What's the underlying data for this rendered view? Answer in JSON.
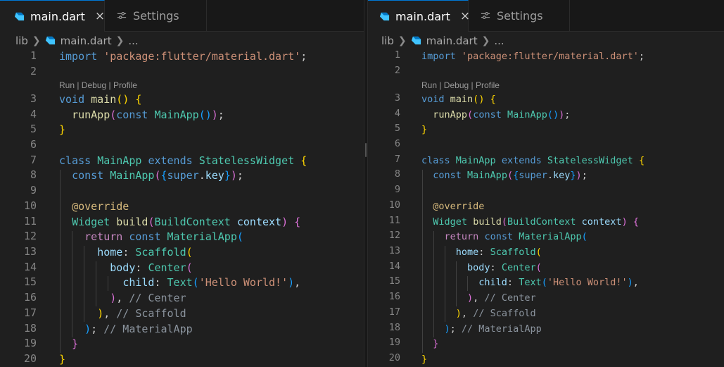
{
  "tabs": [
    {
      "label": "main.dart",
      "active": true,
      "icon": "dart-icon",
      "close": "×"
    },
    {
      "label": "Settings",
      "active": false,
      "icon": "settings-sliders-icon"
    }
  ],
  "breadcrumbs": [
    "lib",
    "main.dart",
    "..."
  ],
  "codelens": "Run | Debug | Profile",
  "line_numbers": [
    "1",
    "2",
    "3",
    "4",
    "5",
    "6",
    "7",
    "8",
    "9",
    "10",
    "11",
    "12",
    "13",
    "14",
    "15",
    "16",
    "17",
    "18",
    "19",
    "20"
  ],
  "code": {
    "l1": [
      "import",
      " ",
      "'package:flutter/material.dart'",
      ";"
    ],
    "l3": [
      "void",
      " ",
      "main",
      "(",
      ")",
      " ",
      "{"
    ],
    "l4": [
      "  ",
      "runApp",
      "(",
      "const",
      " ",
      "MainApp",
      "(",
      ")",
      ")",
      ";"
    ],
    "l5": [
      "}"
    ],
    "l7": [
      "class",
      " ",
      "MainApp",
      " ",
      "extends",
      " ",
      "StatelessWidget",
      " ",
      "{"
    ],
    "l8": [
      "  ",
      "const",
      " ",
      "MainApp",
      "(",
      "{",
      "super",
      ".",
      "key",
      "}",
      ")",
      ";"
    ],
    "l10": [
      "  ",
      "@override"
    ],
    "l11": [
      "  ",
      "Widget",
      " ",
      "build",
      "(",
      "BuildContext",
      " ",
      "context",
      ")",
      " ",
      "{"
    ],
    "l12": [
      "    ",
      "return",
      " ",
      "const",
      " ",
      "MaterialApp",
      "("
    ],
    "l13": [
      "      ",
      "home",
      ": ",
      "Scaffold",
      "("
    ],
    "l14": [
      "        ",
      "body",
      ": ",
      "Center",
      "("
    ],
    "l15": [
      "          ",
      "child",
      ": ",
      "Text",
      "(",
      "'Hello World!'",
      ")",
      ","
    ],
    "l16": [
      "        ",
      ")",
      ", ",
      "// Center"
    ],
    "l17": [
      "      ",
      ")",
      ", ",
      "// Scaffold"
    ],
    "l18": [
      "    ",
      ")",
      "; ",
      "// MaterialApp"
    ],
    "l19": [
      "  ",
      "}"
    ],
    "l20": [
      "}"
    ]
  },
  "colors": {
    "accent": "#0078d4",
    "background": "#1f1f1f",
    "keyword": "#569cd6",
    "string": "#ce9178",
    "function": "#dcdcaa",
    "class": "#4ec9b0"
  }
}
